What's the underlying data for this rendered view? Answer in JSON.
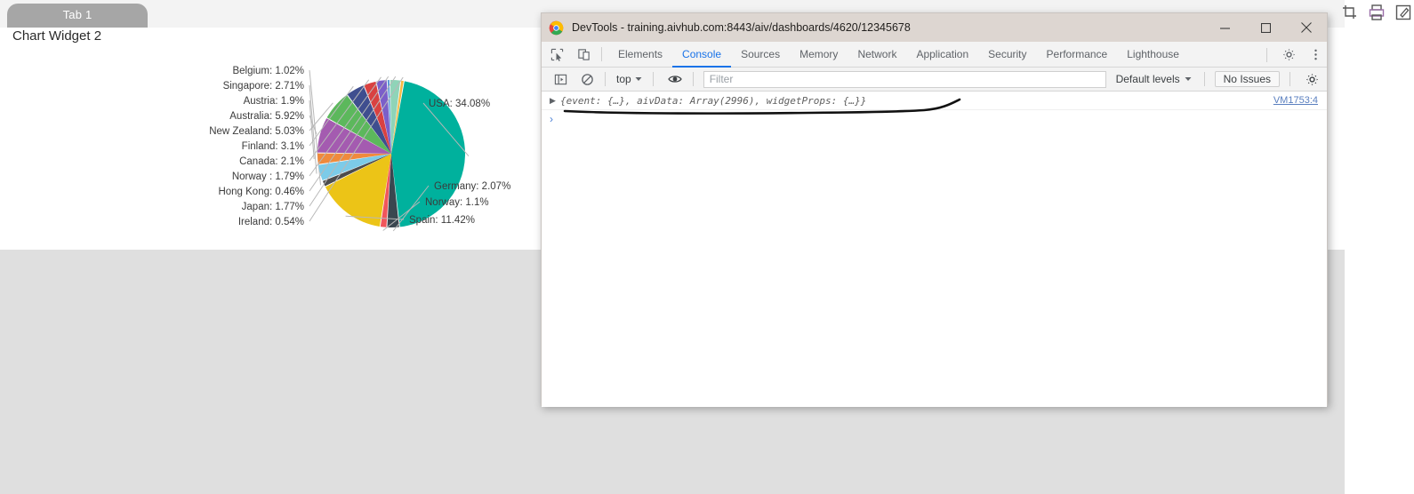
{
  "browser": {
    "tab_label": "Tab 1",
    "widget_title": "Chart Widget 2",
    "top_icons": [
      "crop-icon",
      "print-icon",
      "edit-icon"
    ]
  },
  "chart_data": {
    "type": "pie",
    "title": "Chart Widget 2",
    "label_format": "{name}: {value}%",
    "legend": "labels-outside",
    "categories": [
      "USA",
      "Germany",
      "Norway",
      "Spain",
      "Belgium",
      "Singapore",
      "Austria",
      "Australia",
      "New Zealand",
      "Finland",
      "Canada",
      "Norway ",
      "Hong Kong",
      "Japan",
      "Ireland"
    ],
    "values": [
      34.08,
      2.07,
      1.1,
      11.42,
      1.02,
      2.71,
      1.9,
      5.92,
      5.03,
      3.1,
      2.1,
      1.79,
      0.46,
      1.77,
      0.54
    ],
    "colors": [
      "#00b19d",
      "#3a4750",
      "#f1565b",
      "#ecc417",
      "#4c4c4c",
      "#7ccbe8",
      "#f08a3c",
      "#a45bb0",
      "#5cb85c",
      "#3f4e8f",
      "#d94141",
      "#7b5fc9",
      "#5b9bd5",
      "#8fd4b8",
      "#f5b942"
    ],
    "slices": [
      {
        "label": "USA: 34.08%",
        "name": "USA",
        "value": 34.08,
        "color": "#00b19d"
      },
      {
        "label": "Germany: 2.07%",
        "name": "Germany",
        "value": 2.07,
        "color": "#3a4750"
      },
      {
        "label": "Norway: 1.1%",
        "name": "Norway",
        "value": 1.1,
        "color": "#f1565b"
      },
      {
        "label": "Spain: 11.42%",
        "name": "Spain",
        "value": 11.42,
        "color": "#ecc417"
      },
      {
        "label": "Belgium: 1.02%",
        "name": "Belgium",
        "value": 1.02,
        "color": "#4c4c4c"
      },
      {
        "label": "Singapore: 2.71%",
        "name": "Singapore",
        "value": 2.71,
        "color": "#7ccbe8"
      },
      {
        "label": "Austria: 1.9%",
        "name": "Austria",
        "value": 1.9,
        "color": "#f08a3c"
      },
      {
        "label": "Australia: 5.92%",
        "name": "Australia",
        "value": 5.92,
        "color": "#a45bb0"
      },
      {
        "label": "New Zealand: 5.03%",
        "name": "New Zealand",
        "value": 5.03,
        "color": "#5cb85c"
      },
      {
        "label": "Finland: 3.1%",
        "name": "Finland",
        "value": 3.1,
        "color": "#3f4e8f"
      },
      {
        "label": "Canada: 2.1%",
        "name": "Canada",
        "value": 2.1,
        "color": "#d94141"
      },
      {
        "label": "Norway : 1.79%",
        "name": "Norway ",
        "value": 1.79,
        "color": "#7b5fc9"
      },
      {
        "label": "Hong Kong: 0.46%",
        "name": "Hong Kong",
        "value": 0.46,
        "color": "#5b9bd5"
      },
      {
        "label": "Japan: 1.77%",
        "name": "Japan",
        "value": 1.77,
        "color": "#8fd4b8"
      },
      {
        "label": "Ireland: 0.54%",
        "name": "Ireland",
        "value": 0.54,
        "color": "#f5b942"
      }
    ]
  },
  "devtools": {
    "window_title": "DevTools - training.aivhub.com:8443/aiv/dashboards/4620/12345678",
    "window_controls": {
      "minimize": "minimize-icon",
      "maximize": "maximize-icon",
      "close": "close-icon"
    },
    "left_tools": [
      "inspect-element-icon",
      "device-toolbar-icon"
    ],
    "tabs": [
      {
        "label": "Elements",
        "active": false
      },
      {
        "label": "Console",
        "active": true
      },
      {
        "label": "Sources",
        "active": false
      },
      {
        "label": "Memory",
        "active": false
      },
      {
        "label": "Network",
        "active": false
      },
      {
        "label": "Application",
        "active": false
      },
      {
        "label": "Security",
        "active": false
      },
      {
        "label": "Performance",
        "active": false
      },
      {
        "label": "Lighthouse",
        "active": false
      }
    ],
    "tabbar_right": [
      "settings-gear-icon",
      "more-options-icon"
    ],
    "console_toolbar": {
      "sidebar_toggle": "console-sidebar-icon",
      "clear_console": "clear-console-icon",
      "context": "top",
      "eye": "live-expression-icon",
      "filter_placeholder": "Filter",
      "filter_value": "",
      "levels": "Default levels",
      "issues": "No Issues",
      "settings": "settings-gear-icon"
    },
    "console_log": {
      "disclosure": "▶",
      "message": "{event: {…}, aivData: Array(2996), widgetProps: {…}}",
      "source": "VM1753:4",
      "prompt": "›"
    }
  },
  "annotation": {
    "type": "hand-drawn-underline",
    "color": "#111111"
  }
}
